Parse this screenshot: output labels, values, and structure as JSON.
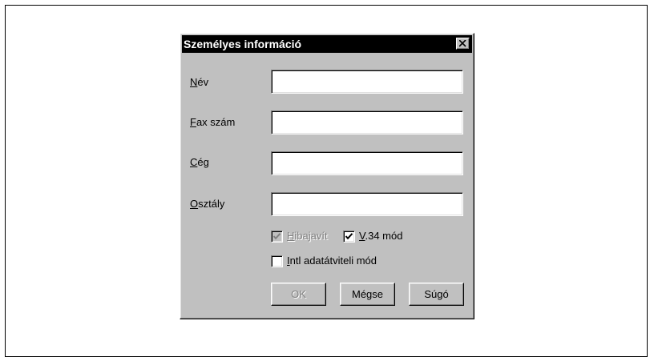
{
  "dialog": {
    "title": "Személyes információ",
    "fields": [
      {
        "accel": "N",
        "rest": "év",
        "value": ""
      },
      {
        "accel": "F",
        "rest": "ax szám",
        "value": ""
      },
      {
        "accel": "C",
        "rest": "ég",
        "value": ""
      },
      {
        "accel": "O",
        "rest": "sztály",
        "value": ""
      }
    ],
    "options": {
      "error_correction": {
        "accel": "H",
        "rest": "ibajavít",
        "checked": true,
        "enabled": false
      },
      "v34_mode": {
        "accel": "V",
        "rest": ".34 mód",
        "checked": true,
        "enabled": true
      },
      "intl_mode": {
        "accel": "I",
        "rest": "ntl adatátviteli mód",
        "checked": false,
        "enabled": true
      }
    },
    "buttons": {
      "ok": "OK",
      "cancel": "Mégse",
      "help": "Súgó"
    }
  },
  "icons": {
    "close": "close-icon",
    "checkmark": "checkmark-icon"
  },
  "colors": {
    "dialog_face": "#c0c0c0",
    "titlebar": "#000000",
    "disabled_text": "#808080"
  }
}
